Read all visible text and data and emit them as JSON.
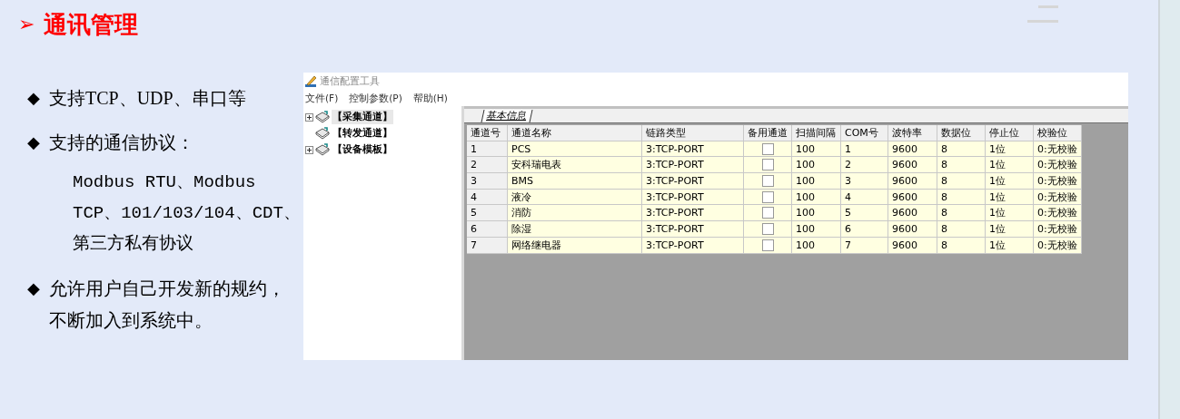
{
  "slide": {
    "title_marker": "➢",
    "title": "通讯管理",
    "bullets": [
      {
        "marker": "◆",
        "lines": [
          "支持TCP、UDP、串口等"
        ]
      },
      {
        "marker": "◆",
        "lines": [
          "支持的通信协议："
        ],
        "sub_lines": [
          "Modbus RTU、Modbus",
          "TCP、101/103/104、CDT、",
          "第三方私有协议"
        ]
      },
      {
        "marker": "◆",
        "lines": [
          "允许用户自己开发新的规约，",
          "不断加入到系统中。"
        ]
      }
    ]
  },
  "window": {
    "title": "通信配置工具",
    "menu": [
      "文件(F)",
      "控制参数(P)",
      "帮助(H)"
    ],
    "tree": [
      {
        "label": "【采集通道】",
        "kind": "folder",
        "expanded": false,
        "selected": true
      },
      {
        "label": "【转发通道】",
        "kind": "leaf",
        "selected": false
      },
      {
        "label": "【设备模板】",
        "kind": "folder",
        "expanded": false,
        "selected": false
      }
    ],
    "tabs": [
      {
        "label": "基本信息",
        "selected": true
      }
    ],
    "table": {
      "columns": [
        "通道号",
        "通道名称",
        "链路类型",
        "备用通道",
        "扫描间隔",
        "COM号",
        "波特率",
        "数据位",
        "停止位",
        "校验位"
      ],
      "rows": [
        {
          "id": "1",
          "name": "PCS",
          "link": "3:TCP-PORT",
          "backup": false,
          "scan": "100",
          "com": "1",
          "baud": "9600",
          "data_bits": "8",
          "stop_bits": "1位",
          "parity": "0:无校验"
        },
        {
          "id": "2",
          "name": "安科瑞电表",
          "link": "3:TCP-PORT",
          "backup": false,
          "scan": "100",
          "com": "2",
          "baud": "9600",
          "data_bits": "8",
          "stop_bits": "1位",
          "parity": "0:无校验"
        },
        {
          "id": "3",
          "name": "BMS",
          "link": "3:TCP-PORT",
          "backup": false,
          "scan": "100",
          "com": "3",
          "baud": "9600",
          "data_bits": "8",
          "stop_bits": "1位",
          "parity": "0:无校验"
        },
        {
          "id": "4",
          "name": "液冷",
          "link": "3:TCP-PORT",
          "backup": false,
          "scan": "100",
          "com": "4",
          "baud": "9600",
          "data_bits": "8",
          "stop_bits": "1位",
          "parity": "0:无校验"
        },
        {
          "id": "5",
          "name": "消防",
          "link": "3:TCP-PORT",
          "backup": false,
          "scan": "100",
          "com": "5",
          "baud": "9600",
          "data_bits": "8",
          "stop_bits": "1位",
          "parity": "0:无校验"
        },
        {
          "id": "6",
          "name": "除湿",
          "link": "3:TCP-PORT",
          "backup": false,
          "scan": "100",
          "com": "6",
          "baud": "9600",
          "data_bits": "8",
          "stop_bits": "1位",
          "parity": "0:无校验"
        },
        {
          "id": "7",
          "name": "网络继电器",
          "link": "3:TCP-PORT",
          "backup": false,
          "scan": "100",
          "com": "7",
          "baud": "9600",
          "data_bits": "8",
          "stop_bits": "1位",
          "parity": "0:无校验"
        }
      ]
    }
  }
}
